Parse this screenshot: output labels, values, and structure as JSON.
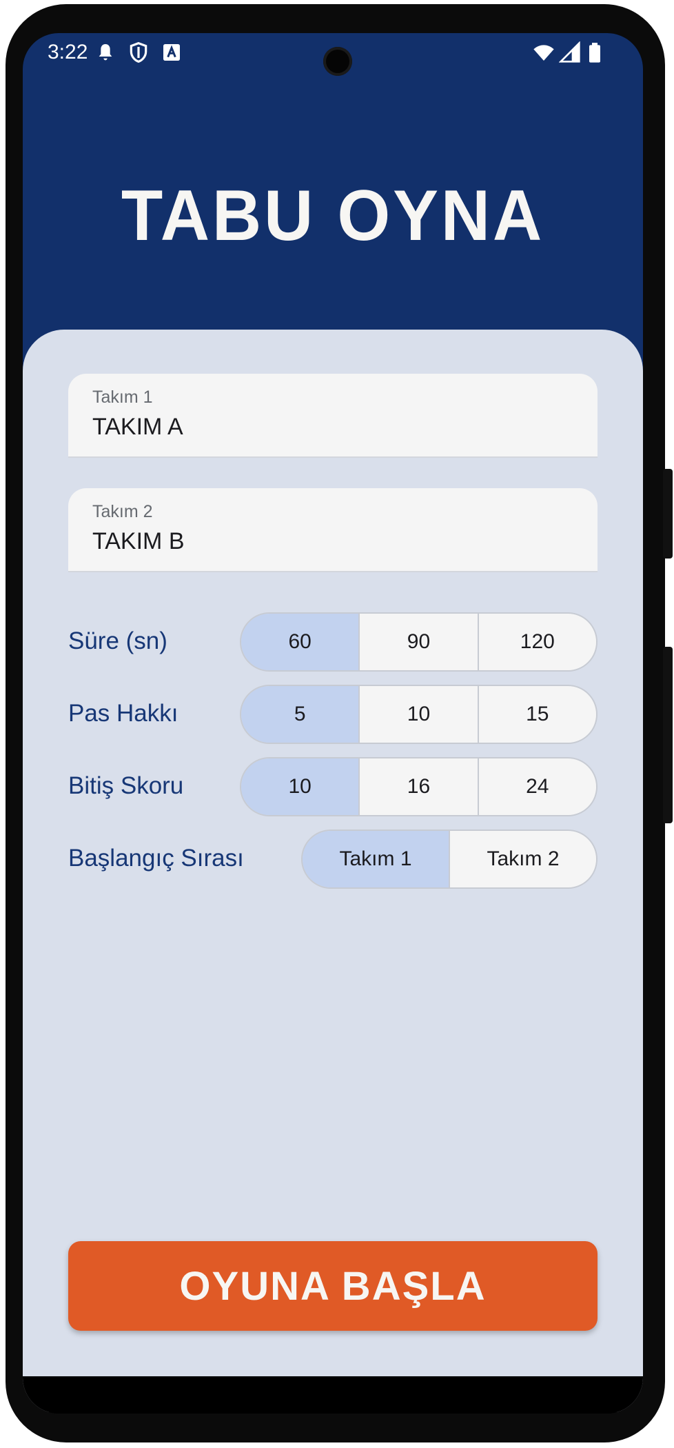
{
  "status": {
    "time": "3:22"
  },
  "app": {
    "title": "TABU OYNA"
  },
  "teams": [
    {
      "label": "Takım 1",
      "value": "TAKIM A"
    },
    {
      "label": "Takım 2",
      "value": "TAKIM B"
    }
  ],
  "options": {
    "duration": {
      "label": "Süre (sn)",
      "choices": [
        "60",
        "90",
        "120"
      ],
      "selected": "60"
    },
    "passes": {
      "label": "Pas Hakkı",
      "choices": [
        "5",
        "10",
        "15"
      ],
      "selected": "5"
    },
    "end_score": {
      "label": "Bitiş Skoru",
      "choices": [
        "10",
        "16",
        "24"
      ],
      "selected": "10"
    },
    "start_order": {
      "label": "Başlangıç Sırası",
      "choices": [
        "Takım 1",
        "Takım 2"
      ],
      "selected": "Takım 1"
    }
  },
  "start_button": {
    "label": "OYUNA BAŞLA"
  },
  "colors": {
    "header": "#12306b",
    "sheet": "#d9dfeb",
    "accent": "#e05a26",
    "selected_segment": "#c2d2ef",
    "label_text": "#173776"
  }
}
